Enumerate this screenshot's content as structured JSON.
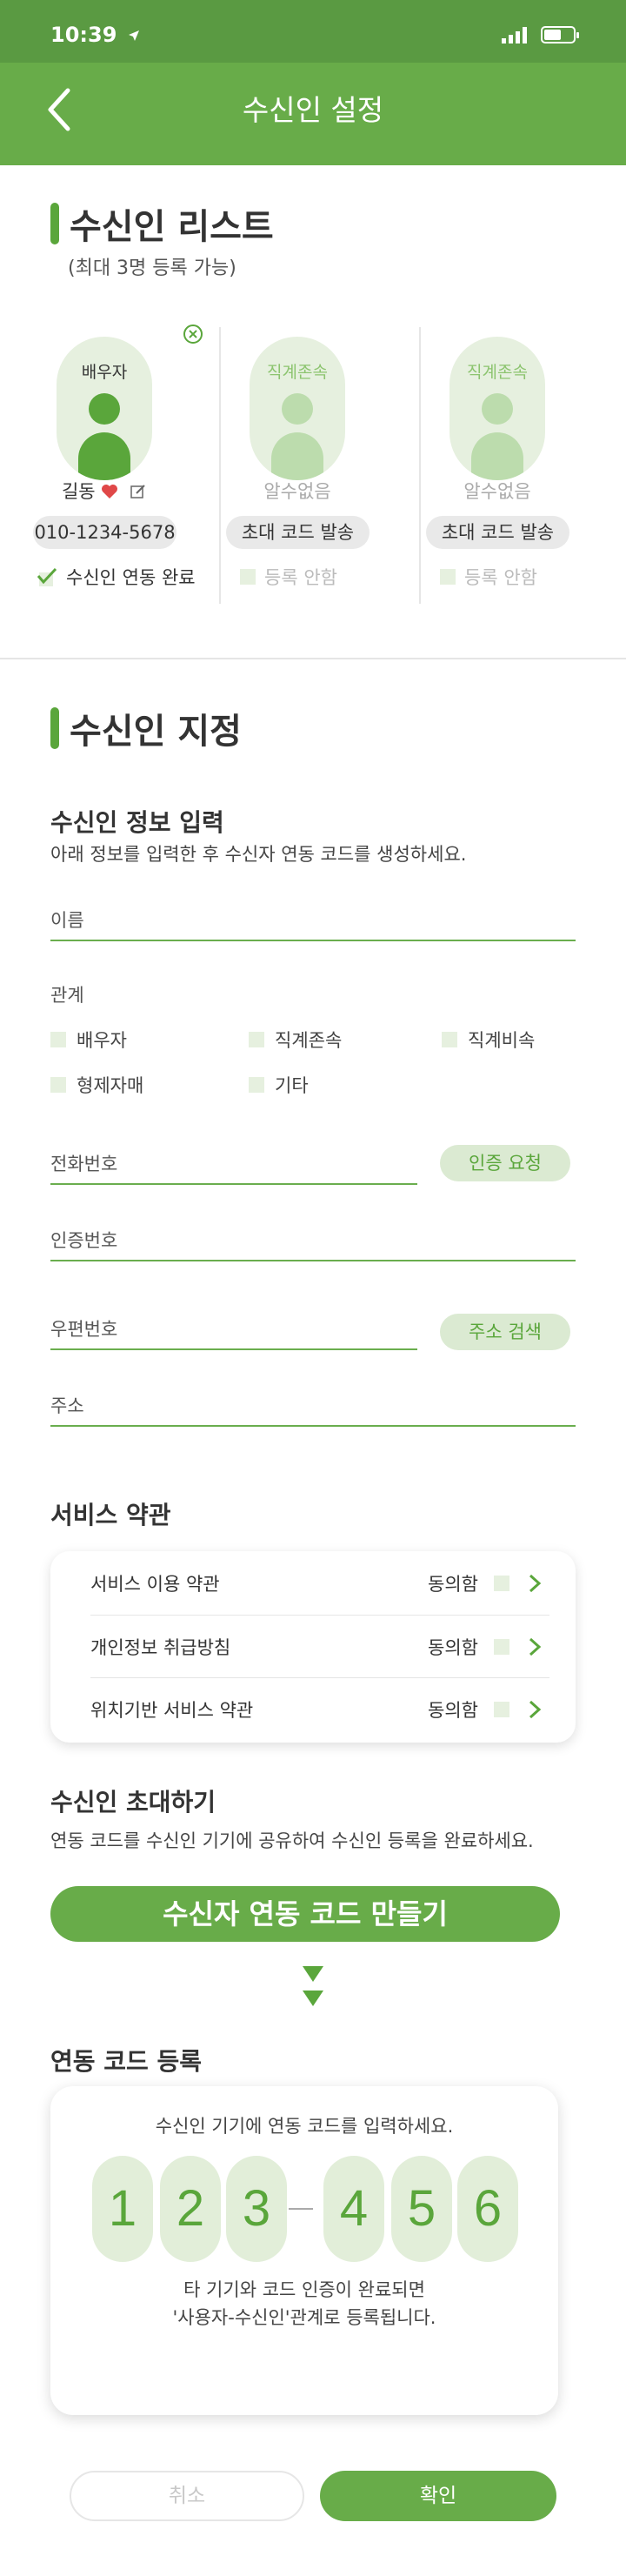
{
  "status_bar": {
    "time": "10:39",
    "icons": [
      "location-arrow-icon",
      "signal-icon",
      "battery-icon"
    ]
  },
  "header": {
    "title": "수신인 설정",
    "back_icon": "chevron-left-icon"
  },
  "recipient_list": {
    "title": "수신인 리스트",
    "subtitle": "(최대 3명 등록 가능)",
    "cards": [
      {
        "role": "배우자",
        "name": "길동",
        "code": "010-1234-5678",
        "status": "수신인 연동 완료",
        "active": true
      },
      {
        "role": "직계존속",
        "name": "알수없음",
        "code": "초대 코드 발송",
        "status": "등록 안함",
        "active": false
      },
      {
        "role": "직계존속",
        "name": "알수없음",
        "code": "초대 코드 발송",
        "status": "등록 안함",
        "active": false
      }
    ]
  },
  "designation": {
    "title": "수신인 지정",
    "info_title": "수신인 정보 입력",
    "info_desc": "아래 정보를 입력한 후 수신자 연동 코드를 생성하세요.",
    "name_placeholder": "이름",
    "relation_label": "관계",
    "relations": [
      "배우자",
      "직계존속",
      "직계비속",
      "형제자매",
      "기타"
    ],
    "phone_placeholder": "전화번호",
    "verify_button": "인증 요청",
    "auth_placeholder": "인증번호",
    "zip_placeholder": "우편번호",
    "address_button": "주소 검색",
    "address_placeholder": "주소"
  },
  "terms": {
    "title": "서비스 약관",
    "items": [
      {
        "label": "서비스 이용 약관",
        "agree": "동의함"
      },
      {
        "label": "개인정보 취급방침",
        "agree": "동의함"
      },
      {
        "label": "위치기반 서비스 약관",
        "agree": "동의함"
      }
    ]
  },
  "invite": {
    "title": "수신인 초대하기",
    "desc": "연동 코드를 수신인 기기에 공유하여 수신인 등록을 완료하세요.",
    "button": "수신자 연동 코드 만들기"
  },
  "code_register": {
    "title": "연동 코드 등록",
    "prompt": "수신인 기기에 연동 코드를 입력하세요.",
    "digits": [
      "1",
      "2",
      "3",
      "4",
      "5",
      "6"
    ],
    "note_line1": "타 기기와 코드 인증이 완료되면",
    "note_line2": "'사용자-수신인'관계로 등록됩니다."
  },
  "footer": {
    "cancel": "취소",
    "confirm": "확인"
  },
  "colors": {
    "primary": "#68ac49",
    "status_bar": "#5a9a42",
    "light_green": "#e6f0df",
    "heart": "#e04848"
  }
}
